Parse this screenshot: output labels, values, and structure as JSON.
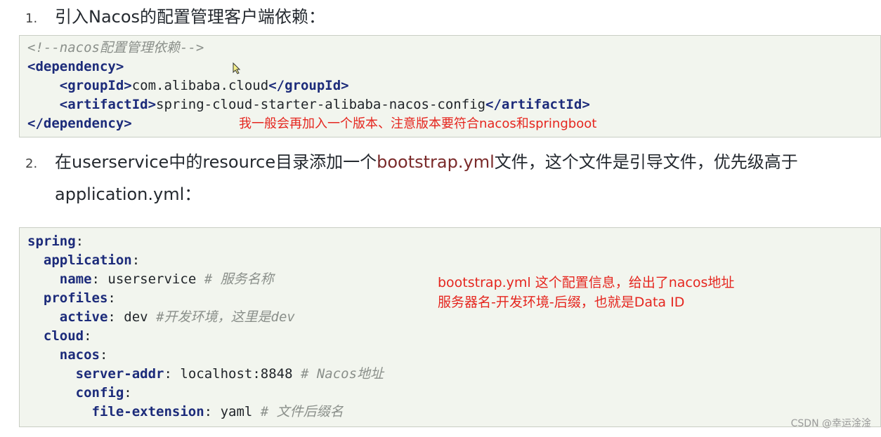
{
  "step1": {
    "number": "1.",
    "text": "引入Nacos的配置管理客户端依赖："
  },
  "code1": {
    "lines": [
      {
        "indent": "",
        "comment": "<!--nacos配置管理依赖-->"
      },
      {
        "indent": "",
        "open": "<dependency>"
      },
      {
        "indent": "    ",
        "open": "<groupId>",
        "value": "com.alibaba.cloud",
        "close": "</groupId>"
      },
      {
        "indent": "    ",
        "open": "<artifactId>",
        "value": "spring-cloud-starter-alibaba-nacos-config",
        "close": "</artifactId>"
      },
      {
        "indent": "",
        "close": "</dependency>"
      }
    ],
    "annotation": "我一般会再加入一个版本、注意版本要符合nacos和springboot"
  },
  "step2": {
    "number": "2.",
    "text_before": "在userservice中的resource目录添加一个",
    "highlight": "bootstrap.yml",
    "text_after": "文件，这个文件是引导文件，优先级高于",
    "line2": "application.yml："
  },
  "code2": {
    "lines": [
      {
        "indent": "",
        "key": "spring",
        "value": "",
        "comment": ""
      },
      {
        "indent": "  ",
        "key": "application",
        "value": "",
        "comment": ""
      },
      {
        "indent": "    ",
        "key": "name",
        "value": " userservice",
        "comment": " # 服务名称"
      },
      {
        "indent": "  ",
        "key": "profiles",
        "value": "",
        "comment": ""
      },
      {
        "indent": "    ",
        "key": "active",
        "value": " dev",
        "comment": " #开发环境，这里是dev"
      },
      {
        "indent": "  ",
        "key": "cloud",
        "value": "",
        "comment": ""
      },
      {
        "indent": "    ",
        "key": "nacos",
        "value": "",
        "comment": ""
      },
      {
        "indent": "      ",
        "key": "server-addr",
        "value": " localhost:8848",
        "comment": " # Nacos地址"
      },
      {
        "indent": "      ",
        "key": "config",
        "value": "",
        "comment": ""
      },
      {
        "indent": "        ",
        "key": "file-extension",
        "value": " yaml",
        "comment": " # 文件后缀名"
      }
    ],
    "annotation_line1": "bootstrap.yml 这个配置信息，给出了nacos地址",
    "annotation_line2": "服务器名-开发环境-后缀，也就是Data ID"
  },
  "watermark": "CSDN @幸运淦淦",
  "colors": {
    "annotation": "#e5261f",
    "code_background": "#f2f5ee",
    "tag": "#1c2b7a",
    "highlight": "#7a2a2a"
  }
}
